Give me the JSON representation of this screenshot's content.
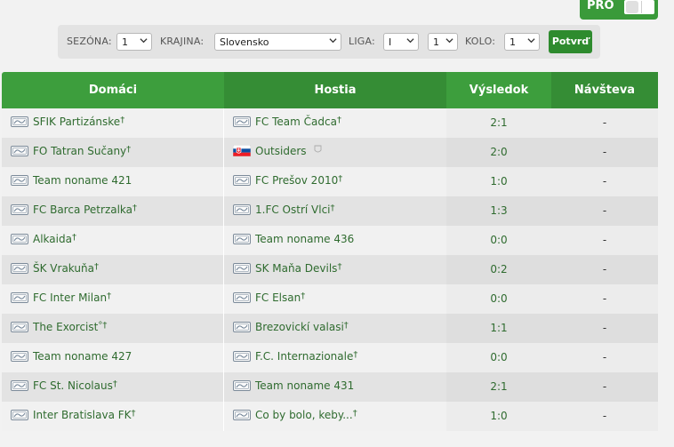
{
  "pro": {
    "label": "PRO"
  },
  "filters": {
    "season_label": "SEZÓNA:",
    "season_value": "1",
    "country_label": "KRAJINA:",
    "country_value": "Slovensko",
    "league_label": "LIGA:",
    "league_value": "I",
    "league_group_value": "1",
    "round_label": "KOLO:",
    "round_value": "1",
    "confirm_label": "Potvrď"
  },
  "table": {
    "headers": {
      "home": "Domáci",
      "guest": "Hostia",
      "result": "Výsledok",
      "attendance": "Návšteva"
    },
    "rows": [
      {
        "home": "SFIK Partizánske",
        "home_mark": "†",
        "guest": "FC Team Čadca",
        "guest_mark": "†",
        "result": "2:1",
        "attendance": "-"
      },
      {
        "home": "FO Tatran Sučany",
        "home_mark": "†",
        "guest": "Outsiders",
        "guest_mark": "",
        "guest_flag": true,
        "result": "2:0",
        "attendance": "-"
      },
      {
        "home": "Team noname 421",
        "home_mark": "",
        "guest": "FC Prešov 2010",
        "guest_mark": "†",
        "result": "1:0",
        "attendance": "-"
      },
      {
        "home": "FC Barca Petrzalka",
        "home_mark": "†",
        "guest": "1.FC Ostrí Vlci",
        "guest_mark": "†",
        "result": "1:3",
        "attendance": "-"
      },
      {
        "home": "Alkaida",
        "home_mark": "†",
        "guest": "Team noname 436",
        "guest_mark": "",
        "result": "0:0",
        "attendance": "-"
      },
      {
        "home": "ŠK Vrakuňa",
        "home_mark": "†",
        "guest": "SK Maňa Devils",
        "guest_mark": "†",
        "result": "0:2",
        "attendance": "-"
      },
      {
        "home": "FC Inter Milan",
        "home_mark": "†",
        "guest": "FC Elsan",
        "guest_mark": "†",
        "result": "0:0",
        "attendance": "-"
      },
      {
        "home": "The Exorcist",
        "home_mark": "°†",
        "guest": "Brezovickí valasi",
        "guest_mark": "†",
        "result": "1:1",
        "attendance": "-"
      },
      {
        "home": "Team noname 427",
        "home_mark": "",
        "guest": "F.C. Internazionale",
        "guest_mark": "†",
        "result": "0:0",
        "attendance": "-"
      },
      {
        "home": "FC St. Nicolaus",
        "home_mark": "†",
        "guest": "Team noname 431",
        "guest_mark": "",
        "result": "2:1",
        "attendance": "-"
      },
      {
        "home": "Inter Bratislava FK",
        "home_mark": "†",
        "guest": "Co by bolo, keby...",
        "guest_mark": "†",
        "result": "1:0",
        "attendance": "-"
      }
    ]
  },
  "colors": {
    "accent_green": "#3d9e3d",
    "link_green": "#2f6b2f"
  }
}
